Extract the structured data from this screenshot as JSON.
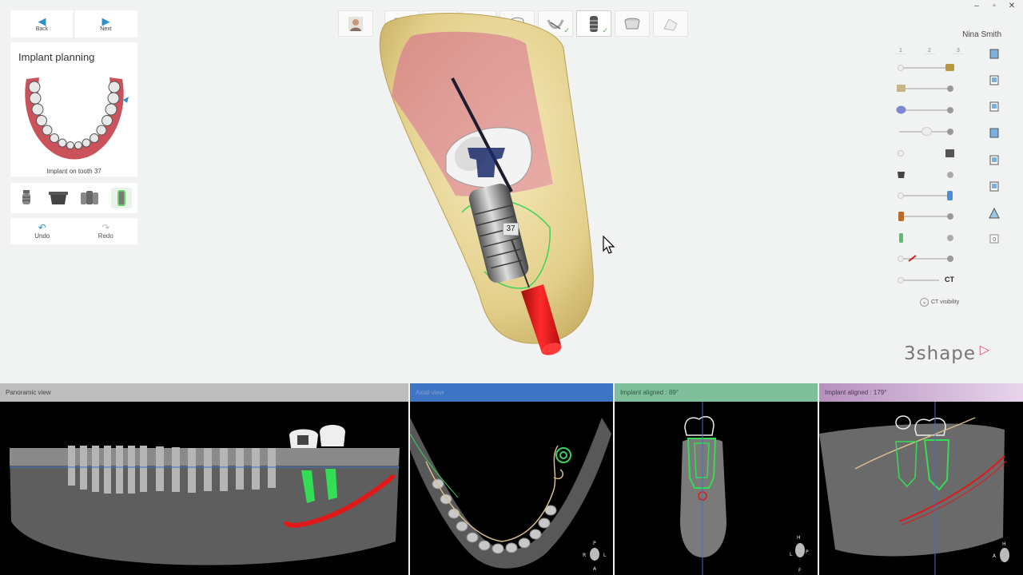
{
  "window": {
    "controls": [
      "–",
      "▫",
      "✕"
    ]
  },
  "nav": {
    "back_label": "Back",
    "next_label": "Next"
  },
  "plan": {
    "title": "Implant planning",
    "caption": "Implant on tooth 37"
  },
  "tools": [
    "implant-icon",
    "abutment-icon",
    "multi-implant-icon",
    "implant-selected-icon"
  ],
  "history": {
    "undo_label": "Undo",
    "redo_label": "Redo"
  },
  "workflow": {
    "steps": [
      {
        "name": "patient-step",
        "done": false
      },
      {
        "name": "scan-step",
        "done": true
      },
      {
        "name": "align-step",
        "done": true
      },
      {
        "name": "segment-step",
        "done": true
      },
      {
        "name": "tooth-step",
        "done": true
      },
      {
        "name": "nerve-step",
        "done": true
      },
      {
        "name": "implant-step",
        "done": true,
        "current": true
      },
      {
        "name": "sleeve-step",
        "done": false
      },
      {
        "name": "guide-step",
        "done": false
      }
    ]
  },
  "user": {
    "name": "Nina Smith"
  },
  "visibility": {
    "tabs": [
      "1",
      "2",
      "3"
    ],
    "ct_label": "CT",
    "ct_visibility_label": "CT visibility"
  },
  "viewport": {
    "tooth_label": "37"
  },
  "panels": {
    "panoramic": "Panoramic view",
    "axial": "Axial view",
    "aligned89": "Implant aligned : 89°",
    "aligned179": "Implant aligned : 179°"
  },
  "orient": {
    "axial": [
      "P",
      "R",
      "L",
      "A"
    ],
    "aligned89": [
      "H",
      "L",
      "P",
      "F"
    ],
    "aligned179": [
      "H",
      "A"
    ]
  },
  "logo": {
    "text": "3shape"
  },
  "colors": {
    "accent": "#2f8fc6",
    "check": "#4caf50",
    "implant": "#33dd55",
    "nerve": "#e01818"
  }
}
